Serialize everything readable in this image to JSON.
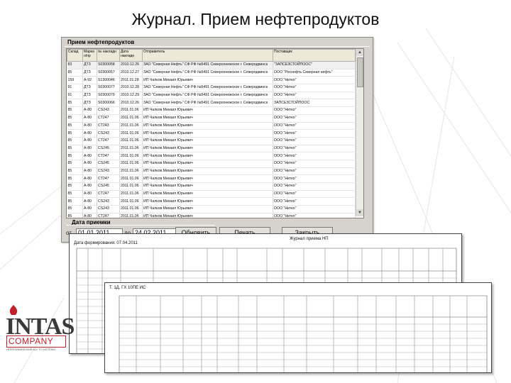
{
  "page": {
    "title": "Журнал. Прием нефтепродуктов"
  },
  "window": {
    "group_caption": "Прием нефтепродуктов",
    "columns": [
      "Склад",
      "Марка н/пр",
      "№ накладн",
      "Дата накладн",
      "Отправитель",
      "Поставщик"
    ],
    "rows": [
      [
        "83",
        "ДТЗ",
        "S0300058",
        "2010.12.26",
        "ЗАО \"Северная Нефть\" СФ РФ №5491 Североонежское г. Северодвинск",
        "\"ЗАПСЕЗСТОЙПООС\""
      ],
      [
        "85",
        "ДТЗ",
        "S0300057",
        "2010.12.27",
        "ЗАО \"Северная Нефть\" СФ РФ №5491 Североонежское г. Северодвинск",
        "ООО \"Роснефть Северная нефть\""
      ],
      [
        "159",
        "А-92",
        "S1300046",
        "2011.01.28",
        "ИП Чалков Михаил Юрьевич",
        "ООО \"Нитко\""
      ],
      [
        "91",
        "ДТЗ",
        "S0300077",
        "2010.12.28",
        "ЗАО \"Северная Нефть\" СФ РФ №5491 Североонежское г. Северодвинск",
        "ООО \"Нитко\""
      ],
      [
        "91",
        "ДТЗ",
        "S0300079",
        "2010.12.29",
        "ЗАО \"Северная Нефть\" СФ РФ №5491 Североонежское г. Северодвинск",
        "ООО \"Нитко\""
      ],
      [
        "85",
        "ДТЗ",
        "S0300066",
        "2010.12.26",
        "ЗАО \"Северная Нефть\" СФ РФ №5491 Североонежское г. Северодвинск",
        "ЗАПСЕЗСТОЙПООС"
      ],
      [
        "85",
        "А-80",
        "CS243",
        "2011.01.06",
        "ИП Чалков Михаил Юрьевич",
        "ООО \"Нитко\""
      ],
      [
        "85",
        "А-80",
        "CT247",
        "2011.01.06",
        "ИП Чалков Михаил Юрьевич",
        "ООО \"Нитко\""
      ],
      [
        "85",
        "А-80",
        "CT243",
        "2011.01.06",
        "ИП Чалков Михаил Юрьевич",
        "ООО \"Нитко\""
      ],
      [
        "85",
        "А-80",
        "CS243",
        "2011.01.06",
        "ИП Чалков Михаил Юрьевич",
        "ООО \"Нитко\""
      ],
      [
        "85",
        "А-80",
        "CT247",
        "2011.01.06",
        "ИП Чалков Михаил Юрьевич",
        "ООО \"Нитко\""
      ],
      [
        "85",
        "А-80",
        "CS245",
        "2011.01.06",
        "ИП Чалков Михаил Юрьевич",
        "ООО \"Нитко\""
      ],
      [
        "85",
        "А-80",
        "CT247",
        "2011.01.06",
        "ИП Чалков Михаил Юрьевич",
        "ООО \"Нитко\""
      ],
      [
        "85",
        "А-80",
        "CS245",
        "2011.01.06",
        "ИП Чалков Михаил Юрьевич",
        "ООО \"Нитко\""
      ],
      [
        "85",
        "А-80",
        "CS243",
        "2011.01.06",
        "ИП Чалков Михаил Юрьевич",
        "ООО \"Нитко\""
      ],
      [
        "85",
        "А-80",
        "CT247",
        "2011.01.06",
        "ИП Чалков Михаил Юрьевич",
        "ООО \"Нитко\""
      ],
      [
        "85",
        "А-80",
        "CS245",
        "2011.01.06",
        "ИП Чалков Михаил Юрьевич",
        "ООО \"Нитко\""
      ],
      [
        "85",
        "А-80",
        "CT247",
        "2011.01.06",
        "ИП Чалков Михаил Юрьевич",
        "ООО \"Нитко\""
      ],
      [
        "85",
        "А-80",
        "CS243",
        "2011.01.06",
        "ИП Чалков Михаил Юрьевич",
        "ООО \"Нитко\""
      ],
      [
        "85",
        "А-80",
        "CS243",
        "2011.01.06",
        "ИП Чалков Михаил Юрьевич",
        "ООО \"Нитко\""
      ],
      [
        "85",
        "А-80",
        "CT247",
        "2011.01.06",
        "ИП Чалков Михаил Юрьевич",
        "ООО \"Нитко\""
      ]
    ],
    "date_caption": "Дата приемки",
    "from_label": "от",
    "from_value": "01.01.2011",
    "to_label": "до",
    "to_value": "24.02.2011",
    "refresh_button": "Обновить",
    "print_button": "Печать",
    "close_button": "Закрыть"
  },
  "report1": {
    "title": "Журнал приема НП",
    "header_left": "Дата формирования: 07.04.2011"
  },
  "report2": {
    "header_left": "Т. 1Д. ГХ 10ПЕ ИС"
  },
  "logo": {
    "main": "INTAS",
    "sub": "COMPANY",
    "tagline": "НЕФТЕХИМИЧЕСКИЙ АСУ ТП СИСТЕМЫ"
  },
  "colors": {
    "window_bg": "#d6d3ce",
    "logo_red": "#c0202a",
    "logo_grey": "#3a3a3a"
  }
}
